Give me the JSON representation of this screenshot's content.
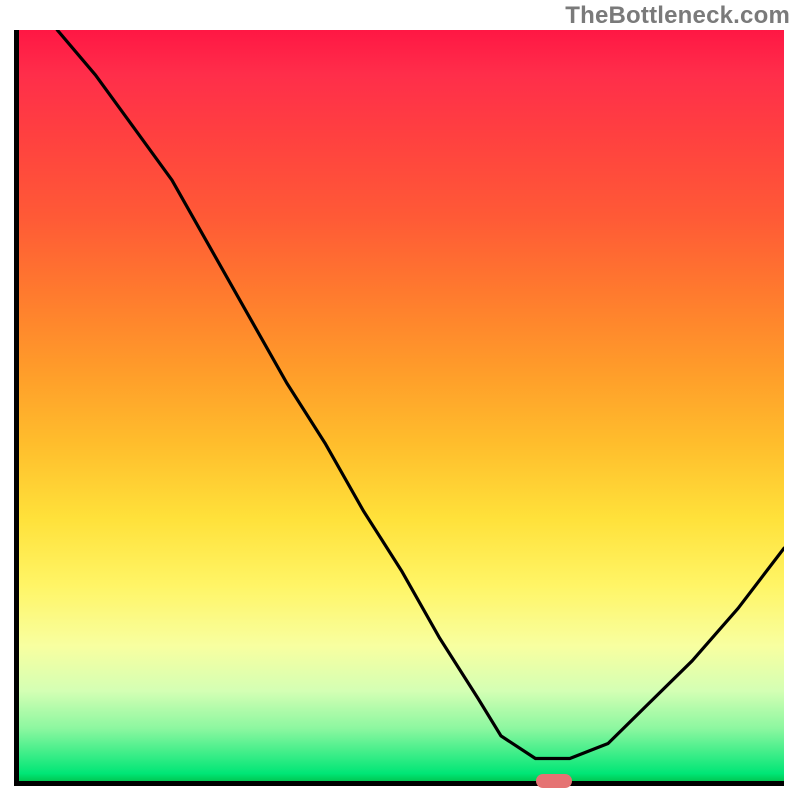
{
  "watermark": "TheBottleneck.com",
  "chart_data": {
    "type": "line",
    "title": "",
    "xlabel": "",
    "ylabel": "",
    "xlim": [
      0,
      100
    ],
    "ylim": [
      0,
      100
    ],
    "grid": false,
    "legend": false,
    "description": "Bottleneck curve over a red-to-green vertical gradient; minimum marked with small pink bar on x-axis",
    "series": [
      {
        "name": "bottleneck-curve",
        "x": [
          5,
          10,
          15,
          20,
          25,
          30,
          35,
          40,
          45,
          50,
          55,
          60,
          63,
          67.5,
          72,
          77,
          82,
          88,
          94,
          100
        ],
        "y": [
          100,
          94,
          87,
          80,
          71,
          62,
          53,
          45,
          36,
          28,
          19,
          11,
          6,
          3,
          3,
          5,
          10,
          16,
          23,
          31
        ]
      }
    ],
    "marker": {
      "x": 69.5,
      "y": 0,
      "color": "#e57373"
    }
  },
  "colors": {
    "gradient_top": "#ff1744",
    "gradient_bottom": "#00c853",
    "curve": "#000000",
    "axis": "#000000",
    "marker": "#e57373",
    "watermark_text": "#7a7a7a"
  }
}
